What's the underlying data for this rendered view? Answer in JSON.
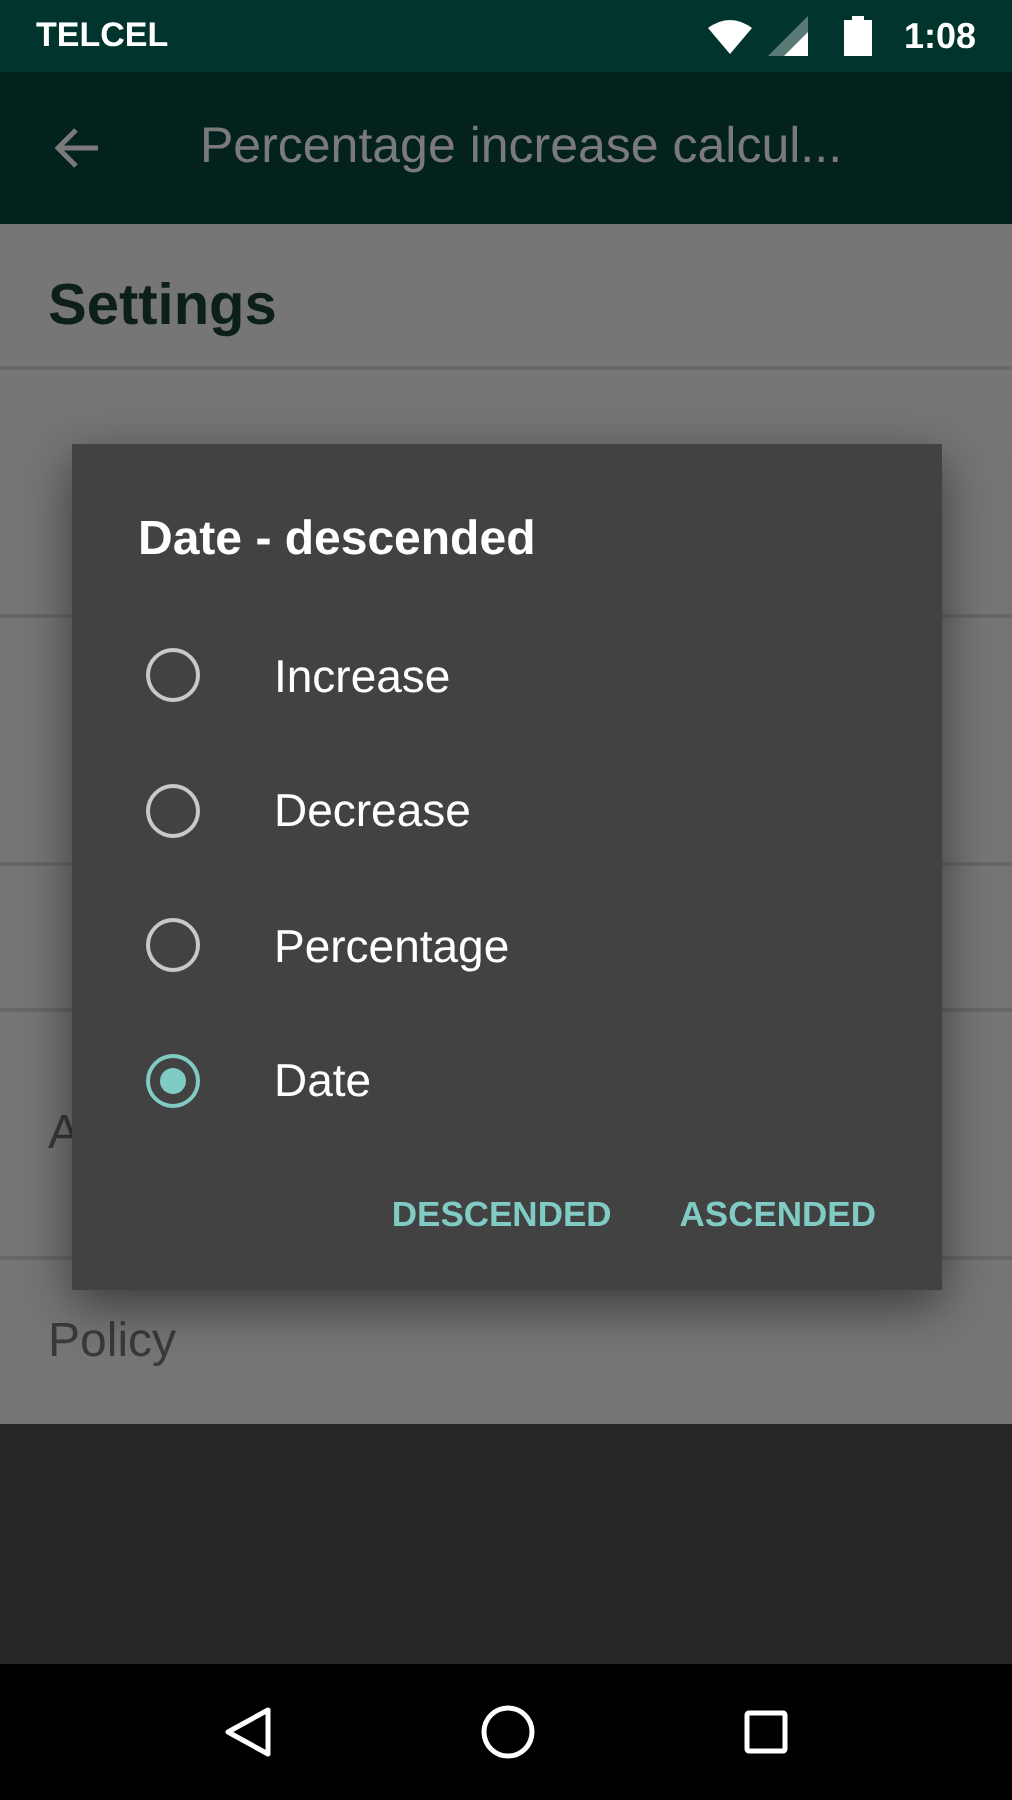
{
  "status_bar": {
    "carrier": "TELCEL",
    "time": "1:08"
  },
  "toolbar": {
    "title": "Percentage increase calcul..."
  },
  "settings": {
    "title": "Settings",
    "items": [
      {
        "kind": "row"
      },
      {
        "kind": "row"
      },
      {
        "kind": "header"
      },
      {
        "kind": "row",
        "label": "A"
      },
      {
        "kind": "row",
        "label": "Policy"
      }
    ]
  },
  "dialog": {
    "title": "Date - descended",
    "options": [
      {
        "label": "Increase",
        "selected": false
      },
      {
        "label": "Decrease",
        "selected": false
      },
      {
        "label": "Percentage",
        "selected": false
      },
      {
        "label": "Date",
        "selected": true
      }
    ],
    "buttons": [
      "DESCENDED",
      "ASCENDED"
    ]
  }
}
